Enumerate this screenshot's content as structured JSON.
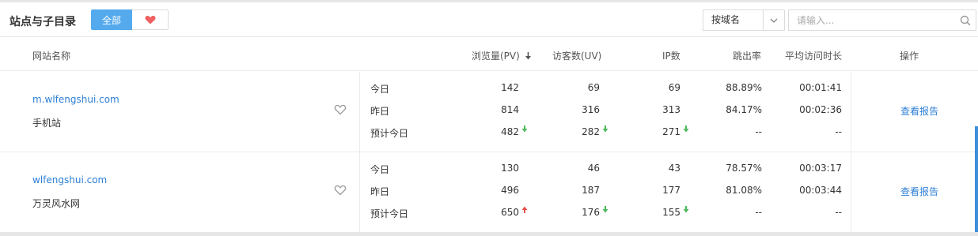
{
  "header": {
    "title": "站点与子目录",
    "filter_all": "全部",
    "filter_fav_icon": "heart-icon",
    "select_value": "按域名",
    "search_placeholder": "请输入..."
  },
  "columns": {
    "site": "网站名称",
    "pv": "浏览量(PV)",
    "uv": "访客数(UV)",
    "ip": "IP数",
    "bounce": "跳出率",
    "avg_time": "平均访问时长",
    "action": "操作"
  },
  "sites": [
    {
      "url": "m.wlfengshui.com",
      "name": "手机站",
      "action": "查看报告",
      "rows": [
        {
          "label": "今日",
          "pv": "142",
          "uv": "69",
          "ip": "69",
          "bounce": "88.89%",
          "avg": "00:01:41"
        },
        {
          "label": "昨日",
          "pv": "814",
          "uv": "316",
          "ip": "313",
          "bounce": "84.17%",
          "avg": "00:02:36"
        },
        {
          "label": "预计今日",
          "pv": "482",
          "uv": "282",
          "ip": "271",
          "bounce": "--",
          "avg": "--",
          "trend": {
            "pv": "down",
            "uv": "down",
            "ip": "down"
          }
        }
      ]
    },
    {
      "url": "wlfengshui.com",
      "name": "万灵风水网",
      "action": "查看报告",
      "rows": [
        {
          "label": "今日",
          "pv": "130",
          "uv": "46",
          "ip": "43",
          "bounce": "78.57%",
          "avg": "00:03:17"
        },
        {
          "label": "昨日",
          "pv": "496",
          "uv": "187",
          "ip": "177",
          "bounce": "81.08%",
          "avg": "00:03:44"
        },
        {
          "label": "预计今日",
          "pv": "650",
          "uv": "176",
          "ip": "155",
          "bounce": "--",
          "avg": "--",
          "trend": {
            "pv": "up",
            "uv": "down",
            "ip": "down"
          }
        }
      ]
    }
  ],
  "colors": {
    "accent": "#55aaee",
    "link": "#2d7fd6",
    "up": "#e8504a",
    "down": "#4cb85c",
    "heart": "#f06060"
  }
}
